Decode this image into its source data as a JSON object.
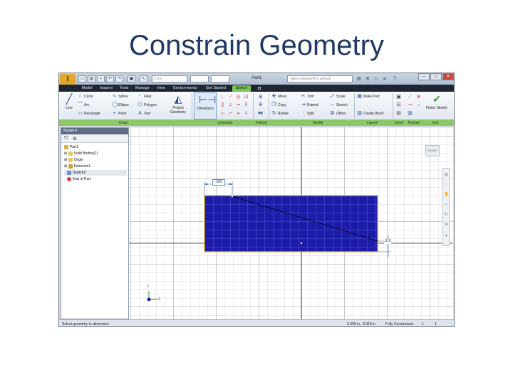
{
  "slide": {
    "title": "Constrain Geometry"
  },
  "app": {
    "window_title": "Part1",
    "style_combo": "Color",
    "search_placeholder": "Type a keyword or phrase"
  },
  "tabs": [
    "Model",
    "Inspect",
    "Tools",
    "Manage",
    "View",
    "Environments",
    "Get Started",
    "Sketch"
  ],
  "active_tab": "Sketch",
  "ribbon": {
    "line": "Line",
    "circle": "Circle",
    "arc": "Arc",
    "rectangle": "Rectangle",
    "spline": "Spline",
    "ellipse": "Ellipse",
    "point": "Point",
    "fillet": "Fillet",
    "polygon": "Polygon",
    "text": "Text",
    "project_geometry": "Project Geometry",
    "dimension": "Dimension",
    "move": "Move",
    "copy": "Copy",
    "rotate": "Rotate",
    "trim": "Trim",
    "extend": "Extend",
    "split": "Split",
    "scale": "Scale",
    "stretch": "Stretch",
    "offset": "Offset",
    "make_part": "Make Part",
    "create_block": "Create Block",
    "finish_sketch": "Finish Sketch",
    "panels": [
      "Draw",
      "Constrain",
      "Pattern",
      "Modify",
      "Layout",
      "Insert",
      "Format",
      "Exit"
    ]
  },
  "browser": {
    "header": "Model",
    "items": [
      "Part1",
      "Solid Bodies(1)",
      "Origin",
      "Extrusion1",
      "Sketch2",
      "End of Part"
    ]
  },
  "canvas": {
    "dimension_top": ".500",
    "dimension_right": ".310",
    "view_cube": "FRONT",
    "triad_x": "X",
    "triad_y": "Y"
  },
  "status": {
    "message": "Select geometry to dimension",
    "coordinates": "2.699 in, -0.318 in",
    "constraint_state": "Fully Constrained",
    "count_a": "1",
    "count_b": "1"
  },
  "colors": {
    "sketch_fill": "#1c1ca8",
    "sketch_tab": "#7cc356",
    "panel_bar": "#8cc867"
  }
}
